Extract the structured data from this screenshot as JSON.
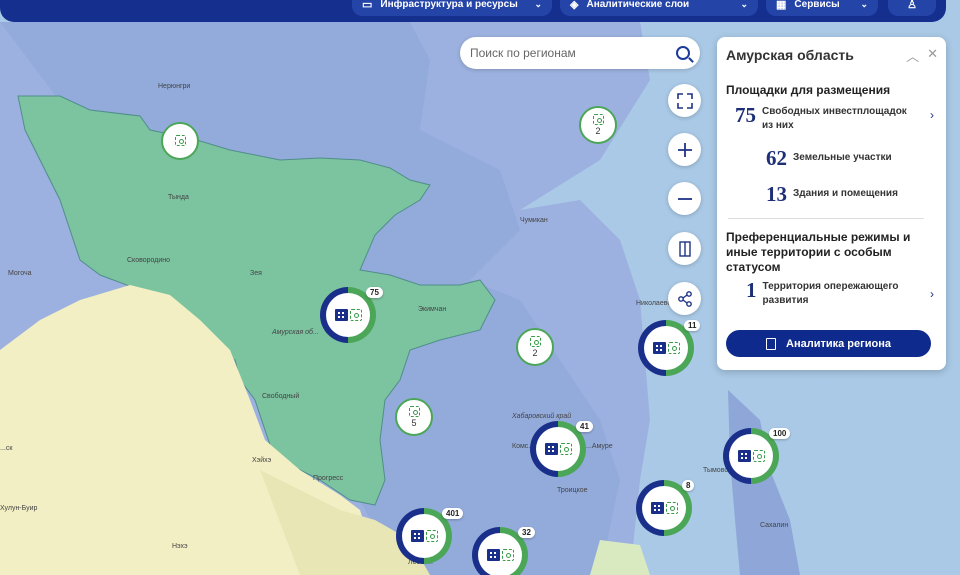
{
  "nav": {
    "items": [
      {
        "label": "Инфраструктура и ресурсы",
        "icon": "layers-icon"
      },
      {
        "label": "Аналитические слои",
        "icon": "stack-icon"
      },
      {
        "label": "Сервисы",
        "icon": "grid-icon"
      }
    ],
    "user_icon": "user-icon"
  },
  "search": {
    "placeholder": "Поиск по регионам",
    "icon": "search-icon"
  },
  "map_controls": [
    "fullscreen-icon",
    "zoom-in-icon",
    "zoom-out-icon",
    "compare-icon",
    "share-icon"
  ],
  "panel": {
    "title": "Амурская область",
    "section1_title": "Площадки для размещения",
    "stat_free": {
      "num": "75",
      "label": "Свободных инвестплощадок из них"
    },
    "stat_land": {
      "num": "62",
      "label": "Земельные участки"
    },
    "stat_buildings": {
      "num": "13",
      "label": "Здания и помещения"
    },
    "section2_title": "Преференциальные режимы и иные территории с особым статусом",
    "stat_tor": {
      "num": "1",
      "label": "Территория опережающего развития"
    },
    "analytics_button": "Аналитика региона"
  },
  "markers": [
    {
      "type": "donut",
      "count": "75"
    },
    {
      "type": "donut",
      "count": "11"
    },
    {
      "type": "donut",
      "count": "41"
    },
    {
      "type": "donut",
      "count": "100"
    },
    {
      "type": "donut",
      "count": "8"
    },
    {
      "type": "donut",
      "count": "401"
    },
    {
      "type": "donut",
      "count": "32"
    },
    {
      "type": "green",
      "count": ""
    },
    {
      "type": "green",
      "count": "2"
    },
    {
      "type": "green",
      "count": "2"
    },
    {
      "type": "green",
      "count": "5"
    }
  ],
  "map_labels": {
    "neryungri": "Нерюнгри",
    "tynda": "Тында",
    "skovorodino": "Сковородино",
    "zeya": "Зея",
    "amurskaya": "Амурская об...",
    "ekimchan": "Экимчан",
    "svobodny": "Свободный",
    "heihe": "Хэйхэ",
    "progress": "Прогресс",
    "mogocha": "Могоча",
    "khabarovsk": "Хабаровский край",
    "troitskoe": "Троицкое",
    "chumikan": "Чумикан",
    "nikolaevsk": "Николаевск",
    "kulun": "Хулун-Буир",
    "nehe": "Нэхэ",
    "sk": "...ск",
    "komsomolsk": "Комс...",
    "amure": "...Амуре",
    "sakhalin": "Сахалин",
    "tymovskoe": "Тымовское",
    "lesnoe": "Лесоз..."
  },
  "colors": {
    "nav": "#142f8e",
    "brand_blue": "#0e2a8c",
    "accent_green": "#4ba657",
    "water": "#a9c9e6",
    "amur_region": "#7cc3a0"
  }
}
